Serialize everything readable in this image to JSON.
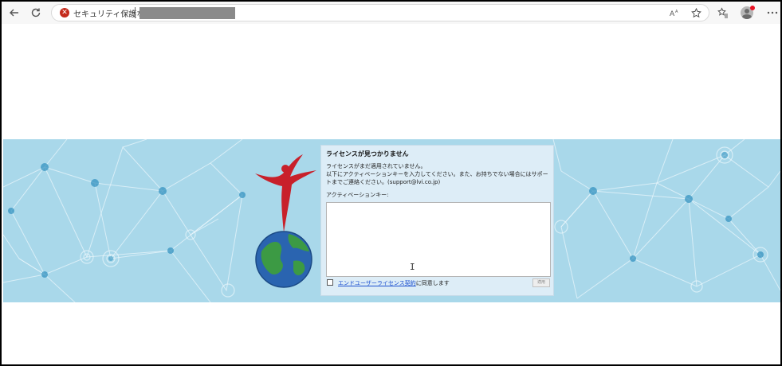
{
  "browser": {
    "security_label": "セキュリティ保護なし",
    "icons": {
      "back": "back-arrow-icon",
      "refresh": "refresh-icon",
      "security": "warning-circle-icon",
      "read_aloud": "read-aloud-icon",
      "favorite": "star-icon",
      "favorites": "favorites-icon",
      "profile": "avatar",
      "more": "more-icon"
    }
  },
  "dialog": {
    "title": "ライセンスが見つかりません",
    "message_line1": "ライセンスがまだ適用されていません。",
    "message_line2": "以下にアクティベーションキーを入力してください。また、お持ちでない場合にはサポートまでご連絡ください。(support@lvi.co.jp)",
    "key_label": "アクティベーションキー:",
    "key_value": "",
    "agree_link": "エンドユーザーライセンス契約",
    "agree_suffix": "に同意します",
    "agree_checked": false,
    "submit_label": "適用"
  },
  "colors": {
    "banner": "#a9d8ea",
    "logo_red": "#c8202a",
    "link": "#1b4fcf",
    "security_red": "#c42b1c"
  }
}
